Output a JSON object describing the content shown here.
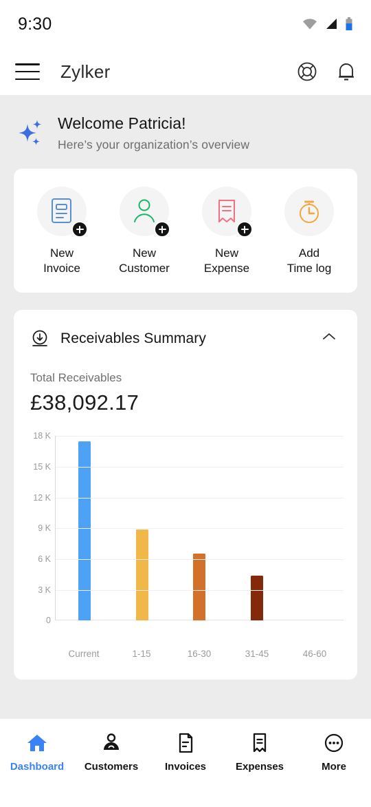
{
  "status_bar": {
    "time": "9:30",
    "icons": [
      "wifi-icon",
      "cellular-signal-icon",
      "battery-icon"
    ],
    "battery_color": "#1a73e8"
  },
  "header": {
    "menu_icon": "hamburger-menu-icon",
    "title": "Zylker",
    "help_icon": "lifebuoy-icon",
    "notification_icon": "bell-icon"
  },
  "welcome": {
    "sparkle_icon": "sparkle-icon",
    "title": "Welcome Patricia!",
    "subtitle": "Here’s your organization’s overview",
    "accent": "#3b6fe0"
  },
  "quick_actions": [
    {
      "label_line1": "New",
      "label_line2": "Invoice",
      "icon": "invoice-document-icon",
      "color": "#5b8fd4",
      "has_plus": true
    },
    {
      "label_line1": "New",
      "label_line2": "Customer",
      "icon": "customer-person-icon",
      "color": "#16b866",
      "has_plus": true
    },
    {
      "label_line1": "New",
      "label_line2": "Expense",
      "icon": "expense-receipt-icon",
      "color": "#f2707f",
      "has_plus": true
    },
    {
      "label_line1": "Add",
      "label_line2": "Time log",
      "icon": "stopwatch-icon",
      "color": "#f5a63c",
      "has_plus": false
    }
  ],
  "receivables": {
    "download_icon": "download-circle-icon",
    "title": "Receivables Summary",
    "collapse_icon": "chevron-up-icon",
    "total_label": "Total Receivables",
    "total_value": "£38,092.17"
  },
  "chart_data": {
    "type": "bar",
    "title": "Receivables Summary",
    "categories": [
      "Current",
      "1-15",
      "16-30",
      "31-45",
      "46-60"
    ],
    "values": [
      17500,
      8900,
      6500,
      4400,
      0
    ],
    "colors": [
      "#4da2f5",
      "#efb849",
      "#d3712b",
      "#85290b",
      "#85290b"
    ],
    "y_ticks": [
      "0",
      "3 K",
      "6 K",
      "9 K",
      "12 K",
      "15 K",
      "18 K"
    ],
    "y_tick_values": [
      0,
      3000,
      6000,
      9000,
      12000,
      15000,
      18000
    ],
    "ylim": [
      0,
      18000
    ],
    "xlabel": "",
    "ylabel": "",
    "grid": true,
    "legend": false
  },
  "bottom_nav": {
    "items": [
      {
        "label": "Dashboard",
        "icon": "home-icon",
        "active": true
      },
      {
        "label": "Customers",
        "icon": "person-icon",
        "active": false
      },
      {
        "label": "Invoices",
        "icon": "document-icon",
        "active": false
      },
      {
        "label": "Expenses",
        "icon": "receipt-icon",
        "active": false
      },
      {
        "label": "More",
        "icon": "ellipsis-circle-icon",
        "active": false
      }
    ],
    "active_color": "#3b82f6"
  }
}
